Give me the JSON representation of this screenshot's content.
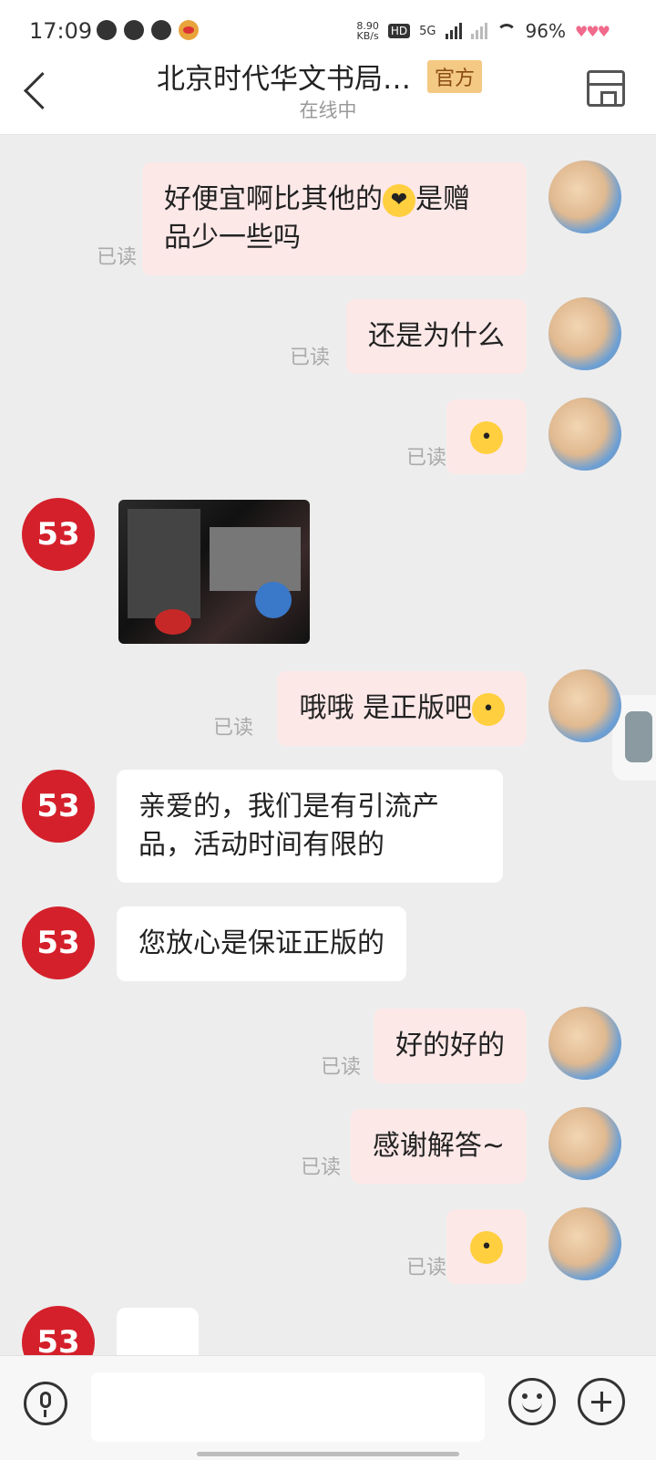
{
  "status_bar": {
    "time": "17:09",
    "speed": "8.90\nKB/s",
    "network": "5G",
    "battery": "96%"
  },
  "header": {
    "title": "北京时代华文书局…",
    "badge": "官方",
    "subtitle": "在线中"
  },
  "shop_avatar_text": "53",
  "messages": [
    {
      "from": "me",
      "text_a": "好便宜啊比其他的",
      "emoji": "😍",
      "text_b": "是赠",
      "text_c": "品少一些吗",
      "status": "已读"
    },
    {
      "from": "me",
      "text": "还是为什么",
      "status": "已读"
    },
    {
      "from": "me",
      "emoji": "😳",
      "status": "已读"
    },
    {
      "from": "shop",
      "type": "image"
    },
    {
      "from": "me",
      "text": "哦哦 是正版吧",
      "emoji": "😚",
      "status": "已读"
    },
    {
      "from": "shop",
      "line1": "亲爱的，我们是有引流产",
      "line2": "品，活动时间有限的"
    },
    {
      "from": "shop",
      "text": "您放心是保证正版的"
    },
    {
      "from": "me",
      "text": "好的好的",
      "status": "已读"
    },
    {
      "from": "me",
      "text": "感谢解答~",
      "status": "已读"
    },
    {
      "from": "me",
      "emoji": "😚",
      "status": "已读"
    }
  ],
  "input": {
    "placeholder": ""
  },
  "icons": [
    "back-icon",
    "store-icon",
    "mic-icon",
    "emoji-icon",
    "plus-icon"
  ]
}
